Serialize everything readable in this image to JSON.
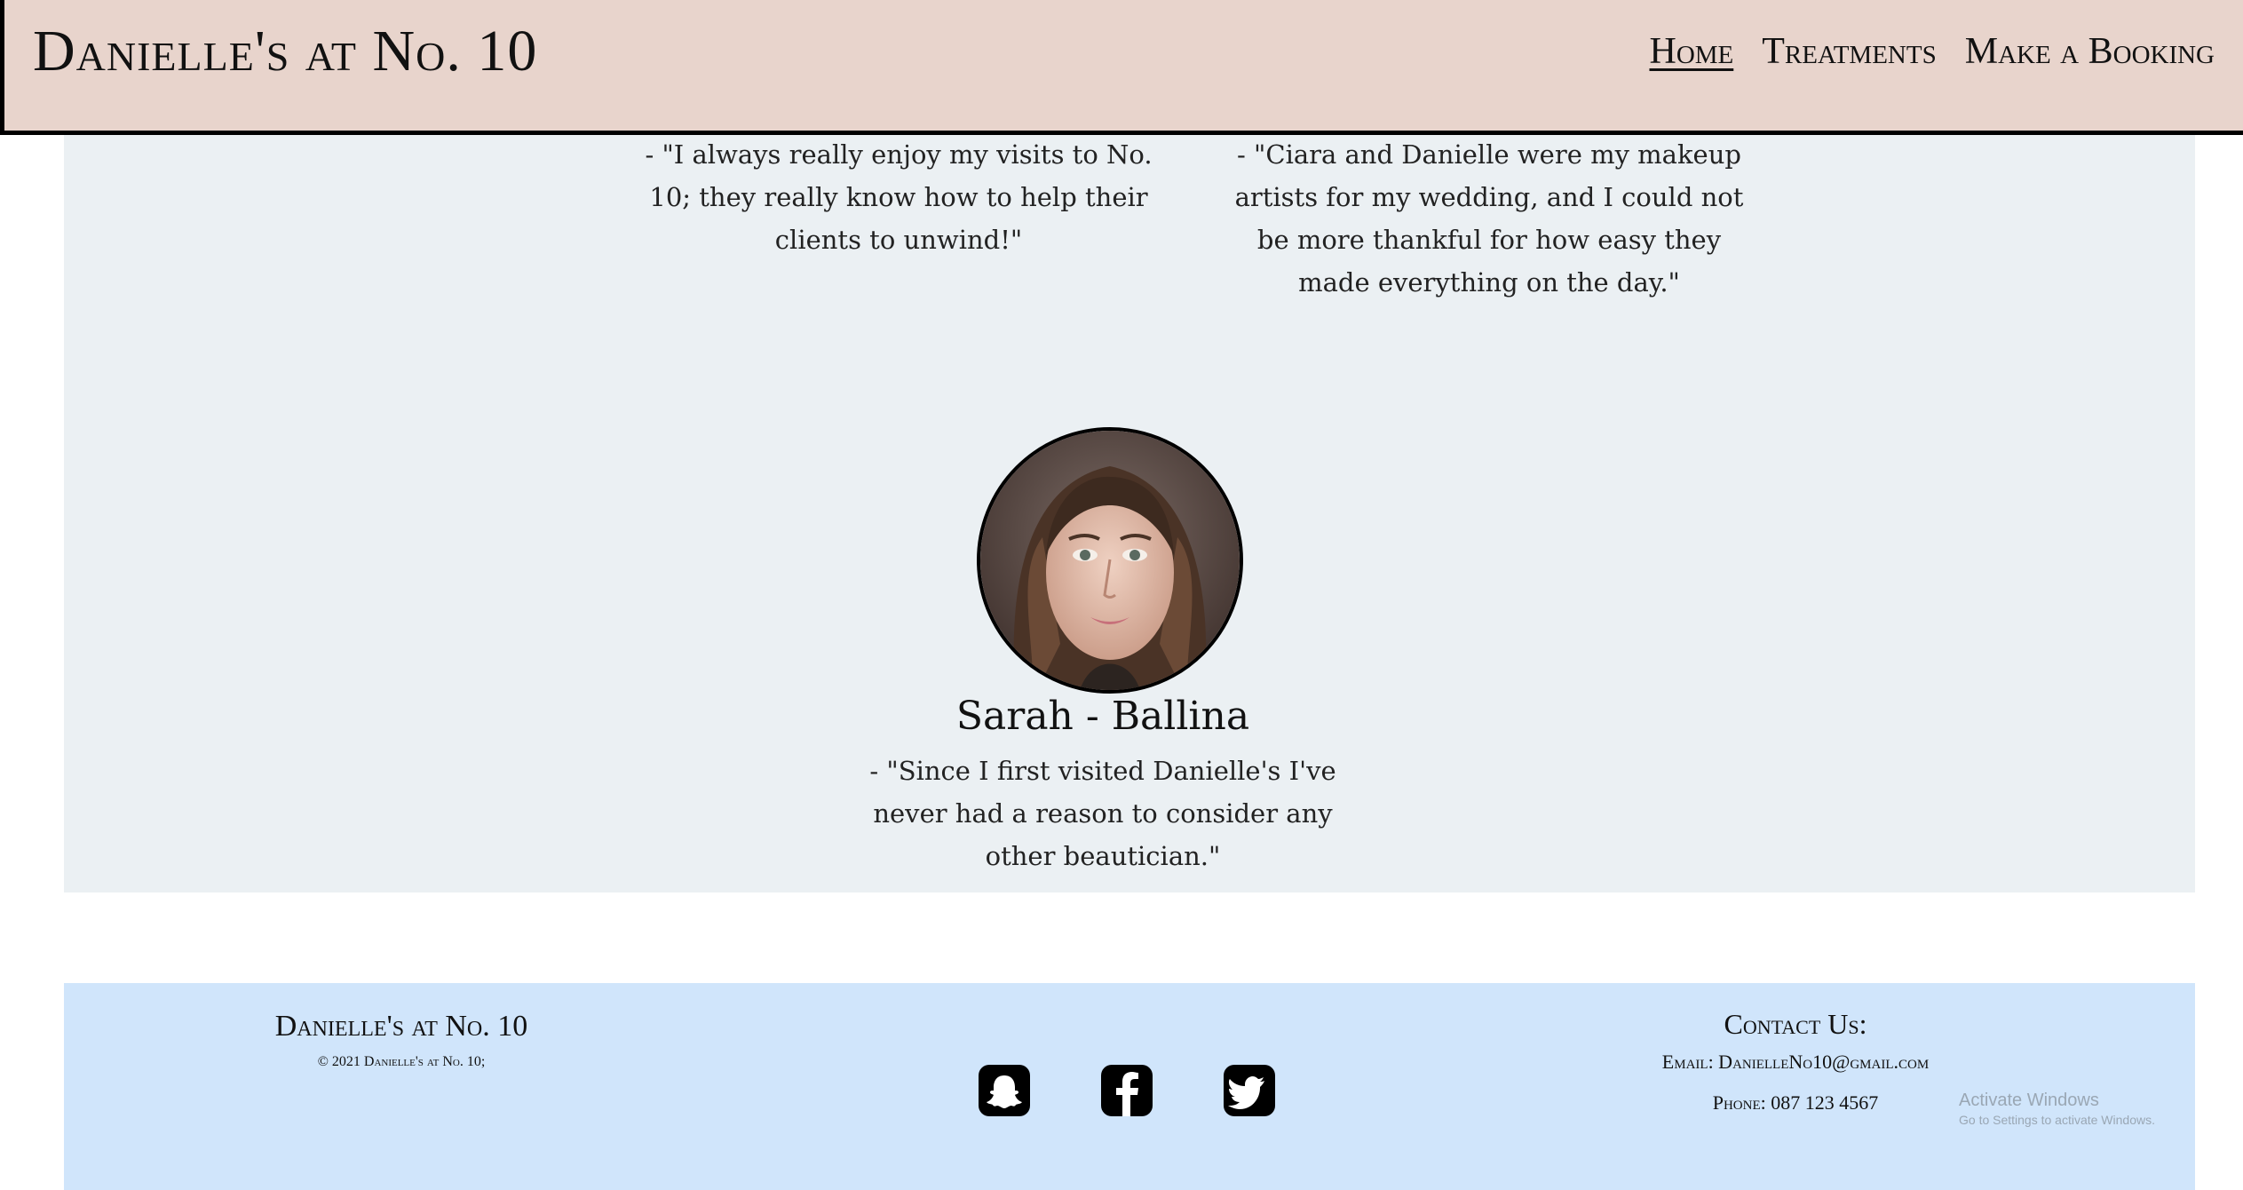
{
  "header": {
    "brand": "Danielle's at No. 10",
    "nav": [
      "Home",
      "Treatments",
      "Make a Booking"
    ]
  },
  "testimonials": [
    {
      "quote": "- \"I always really enjoy my visits to No. 10; they really know how to help their clients to unwind!\""
    },
    {
      "quote": "- \"Ciara and Danielle were my makeup artists for my wedding, and I could not be more thankful for how easy they made everything on the day.\""
    },
    {
      "name": "Sarah - Ballina",
      "quote": "- \"Since I first visited Danielle's I've never had a reason to consider any other beautician.\""
    }
  ],
  "footer": {
    "brand": "Danielle's at No. 10",
    "copyright": "© 2021 Danielle's at No. 10;",
    "socials": [
      "snapchat-icon",
      "facebook-icon",
      "twitter-icon"
    ],
    "contact_title": "Contact Us:",
    "email": "Email: DanielleNo10@gmail.com",
    "phone": "Phone: 087 123 4567"
  },
  "watermark": {
    "line1": "Activate Windows",
    "line2": "Go to Settings to activate Windows."
  }
}
